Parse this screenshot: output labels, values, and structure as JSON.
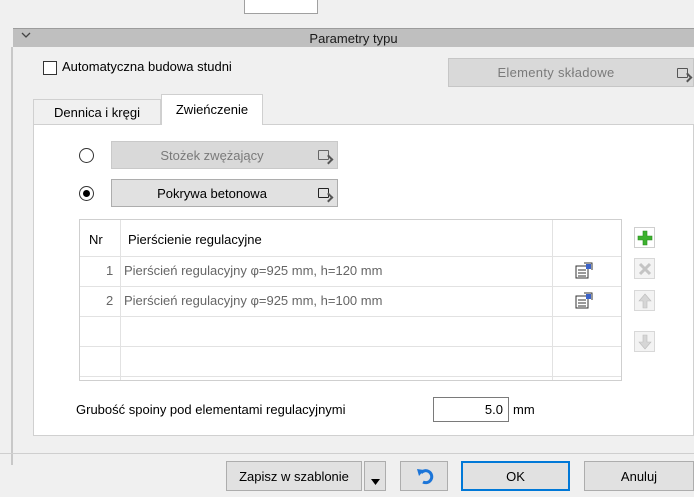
{
  "group": {
    "title": "Parametry typu"
  },
  "auto": {
    "label": "Automatyczna budowa studni",
    "checked": false
  },
  "elementy_button": "Elementy składowe",
  "tabs": [
    {
      "label": "Dennica i kręgi",
      "active": false
    },
    {
      "label": "Zwieńczenie",
      "active": true
    }
  ],
  "options": {
    "stozek": {
      "label": "Stożek zwężający",
      "selected": false,
      "enabled": false
    },
    "pokrywa": {
      "label": "Pokrywa betonowa",
      "selected": true,
      "enabled": true
    }
  },
  "table": {
    "headers": [
      "Nr",
      "Pierścienie regulacyjne"
    ],
    "rows": [
      {
        "nr": "1",
        "name": "Pierścień regulacyjny φ=925 mm, h=120 mm"
      },
      {
        "nr": "2",
        "name": "Pierścień regulacyjny φ=925 mm, h=100 mm"
      }
    ]
  },
  "tools": {
    "add": "plus-icon",
    "delete": "cross-icon",
    "up": "arrow-up-icon",
    "down": "arrow-down-icon"
  },
  "spoina": {
    "label": "Grubość spoiny pod elementami regulacyjnymi",
    "value": "5.0",
    "unit": "mm"
  },
  "footer": {
    "save": "Zapisz w szablonie",
    "ok": "OK",
    "cancel": "Anuluj"
  },
  "colors": {
    "accent": "#0078d7",
    "add_green": "#3cb22e",
    "header_bg": "#bfbfbf"
  }
}
